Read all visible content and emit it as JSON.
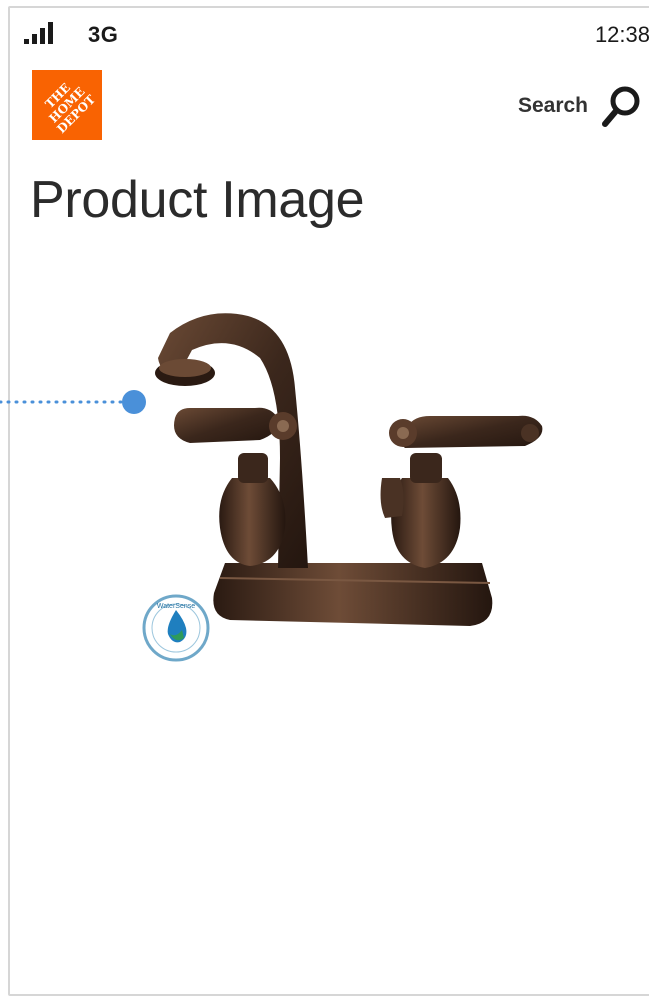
{
  "status_bar": {
    "network": "3G",
    "time": "12:38",
    "signal_bars": 4
  },
  "header": {
    "logo_text": "THE\nHOME\nDEPOT",
    "search_label": "Search"
  },
  "page": {
    "title": "Product Image"
  },
  "product_image": {
    "badge_text": "WaterSense"
  },
  "colors": {
    "brand": "#f96302",
    "callout": "#4a90d9",
    "title": "#2b2b2b"
  }
}
